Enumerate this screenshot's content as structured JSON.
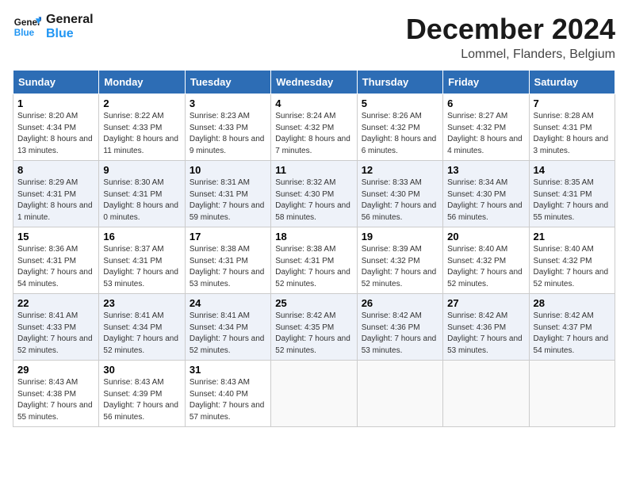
{
  "logo": {
    "line1": "General",
    "line2": "Blue"
  },
  "title": "December 2024",
  "subtitle": "Lommel, Flanders, Belgium",
  "days_of_week": [
    "Sunday",
    "Monday",
    "Tuesday",
    "Wednesday",
    "Thursday",
    "Friday",
    "Saturday"
  ],
  "weeks": [
    [
      {
        "day": "1",
        "sunrise": "Sunrise: 8:20 AM",
        "sunset": "Sunset: 4:34 PM",
        "daylight": "Daylight: 8 hours and 13 minutes."
      },
      {
        "day": "2",
        "sunrise": "Sunrise: 8:22 AM",
        "sunset": "Sunset: 4:33 PM",
        "daylight": "Daylight: 8 hours and 11 minutes."
      },
      {
        "day": "3",
        "sunrise": "Sunrise: 8:23 AM",
        "sunset": "Sunset: 4:33 PM",
        "daylight": "Daylight: 8 hours and 9 minutes."
      },
      {
        "day": "4",
        "sunrise": "Sunrise: 8:24 AM",
        "sunset": "Sunset: 4:32 PM",
        "daylight": "Daylight: 8 hours and 7 minutes."
      },
      {
        "day": "5",
        "sunrise": "Sunrise: 8:26 AM",
        "sunset": "Sunset: 4:32 PM",
        "daylight": "Daylight: 8 hours and 6 minutes."
      },
      {
        "day": "6",
        "sunrise": "Sunrise: 8:27 AM",
        "sunset": "Sunset: 4:32 PM",
        "daylight": "Daylight: 8 hours and 4 minutes."
      },
      {
        "day": "7",
        "sunrise": "Sunrise: 8:28 AM",
        "sunset": "Sunset: 4:31 PM",
        "daylight": "Daylight: 8 hours and 3 minutes."
      }
    ],
    [
      {
        "day": "8",
        "sunrise": "Sunrise: 8:29 AM",
        "sunset": "Sunset: 4:31 PM",
        "daylight": "Daylight: 8 hours and 1 minute."
      },
      {
        "day": "9",
        "sunrise": "Sunrise: 8:30 AM",
        "sunset": "Sunset: 4:31 PM",
        "daylight": "Daylight: 8 hours and 0 minutes."
      },
      {
        "day": "10",
        "sunrise": "Sunrise: 8:31 AM",
        "sunset": "Sunset: 4:31 PM",
        "daylight": "Daylight: 7 hours and 59 minutes."
      },
      {
        "day": "11",
        "sunrise": "Sunrise: 8:32 AM",
        "sunset": "Sunset: 4:30 PM",
        "daylight": "Daylight: 7 hours and 58 minutes."
      },
      {
        "day": "12",
        "sunrise": "Sunrise: 8:33 AM",
        "sunset": "Sunset: 4:30 PM",
        "daylight": "Daylight: 7 hours and 56 minutes."
      },
      {
        "day": "13",
        "sunrise": "Sunrise: 8:34 AM",
        "sunset": "Sunset: 4:30 PM",
        "daylight": "Daylight: 7 hours and 56 minutes."
      },
      {
        "day": "14",
        "sunrise": "Sunrise: 8:35 AM",
        "sunset": "Sunset: 4:31 PM",
        "daylight": "Daylight: 7 hours and 55 minutes."
      }
    ],
    [
      {
        "day": "15",
        "sunrise": "Sunrise: 8:36 AM",
        "sunset": "Sunset: 4:31 PM",
        "daylight": "Daylight: 7 hours and 54 minutes."
      },
      {
        "day": "16",
        "sunrise": "Sunrise: 8:37 AM",
        "sunset": "Sunset: 4:31 PM",
        "daylight": "Daylight: 7 hours and 53 minutes."
      },
      {
        "day": "17",
        "sunrise": "Sunrise: 8:38 AM",
        "sunset": "Sunset: 4:31 PM",
        "daylight": "Daylight: 7 hours and 53 minutes."
      },
      {
        "day": "18",
        "sunrise": "Sunrise: 8:38 AM",
        "sunset": "Sunset: 4:31 PM",
        "daylight": "Daylight: 7 hours and 52 minutes."
      },
      {
        "day": "19",
        "sunrise": "Sunrise: 8:39 AM",
        "sunset": "Sunset: 4:32 PM",
        "daylight": "Daylight: 7 hours and 52 minutes."
      },
      {
        "day": "20",
        "sunrise": "Sunrise: 8:40 AM",
        "sunset": "Sunset: 4:32 PM",
        "daylight": "Daylight: 7 hours and 52 minutes."
      },
      {
        "day": "21",
        "sunrise": "Sunrise: 8:40 AM",
        "sunset": "Sunset: 4:32 PM",
        "daylight": "Daylight: 7 hours and 52 minutes."
      }
    ],
    [
      {
        "day": "22",
        "sunrise": "Sunrise: 8:41 AM",
        "sunset": "Sunset: 4:33 PM",
        "daylight": "Daylight: 7 hours and 52 minutes."
      },
      {
        "day": "23",
        "sunrise": "Sunrise: 8:41 AM",
        "sunset": "Sunset: 4:34 PM",
        "daylight": "Daylight: 7 hours and 52 minutes."
      },
      {
        "day": "24",
        "sunrise": "Sunrise: 8:41 AM",
        "sunset": "Sunset: 4:34 PM",
        "daylight": "Daylight: 7 hours and 52 minutes."
      },
      {
        "day": "25",
        "sunrise": "Sunrise: 8:42 AM",
        "sunset": "Sunset: 4:35 PM",
        "daylight": "Daylight: 7 hours and 52 minutes."
      },
      {
        "day": "26",
        "sunrise": "Sunrise: 8:42 AM",
        "sunset": "Sunset: 4:36 PM",
        "daylight": "Daylight: 7 hours and 53 minutes."
      },
      {
        "day": "27",
        "sunrise": "Sunrise: 8:42 AM",
        "sunset": "Sunset: 4:36 PM",
        "daylight": "Daylight: 7 hours and 53 minutes."
      },
      {
        "day": "28",
        "sunrise": "Sunrise: 8:42 AM",
        "sunset": "Sunset: 4:37 PM",
        "daylight": "Daylight: 7 hours and 54 minutes."
      }
    ],
    [
      {
        "day": "29",
        "sunrise": "Sunrise: 8:43 AM",
        "sunset": "Sunset: 4:38 PM",
        "daylight": "Daylight: 7 hours and 55 minutes."
      },
      {
        "day": "30",
        "sunrise": "Sunrise: 8:43 AM",
        "sunset": "Sunset: 4:39 PM",
        "daylight": "Daylight: 7 hours and 56 minutes."
      },
      {
        "day": "31",
        "sunrise": "Sunrise: 8:43 AM",
        "sunset": "Sunset: 4:40 PM",
        "daylight": "Daylight: 7 hours and 57 minutes."
      },
      null,
      null,
      null,
      null
    ]
  ]
}
